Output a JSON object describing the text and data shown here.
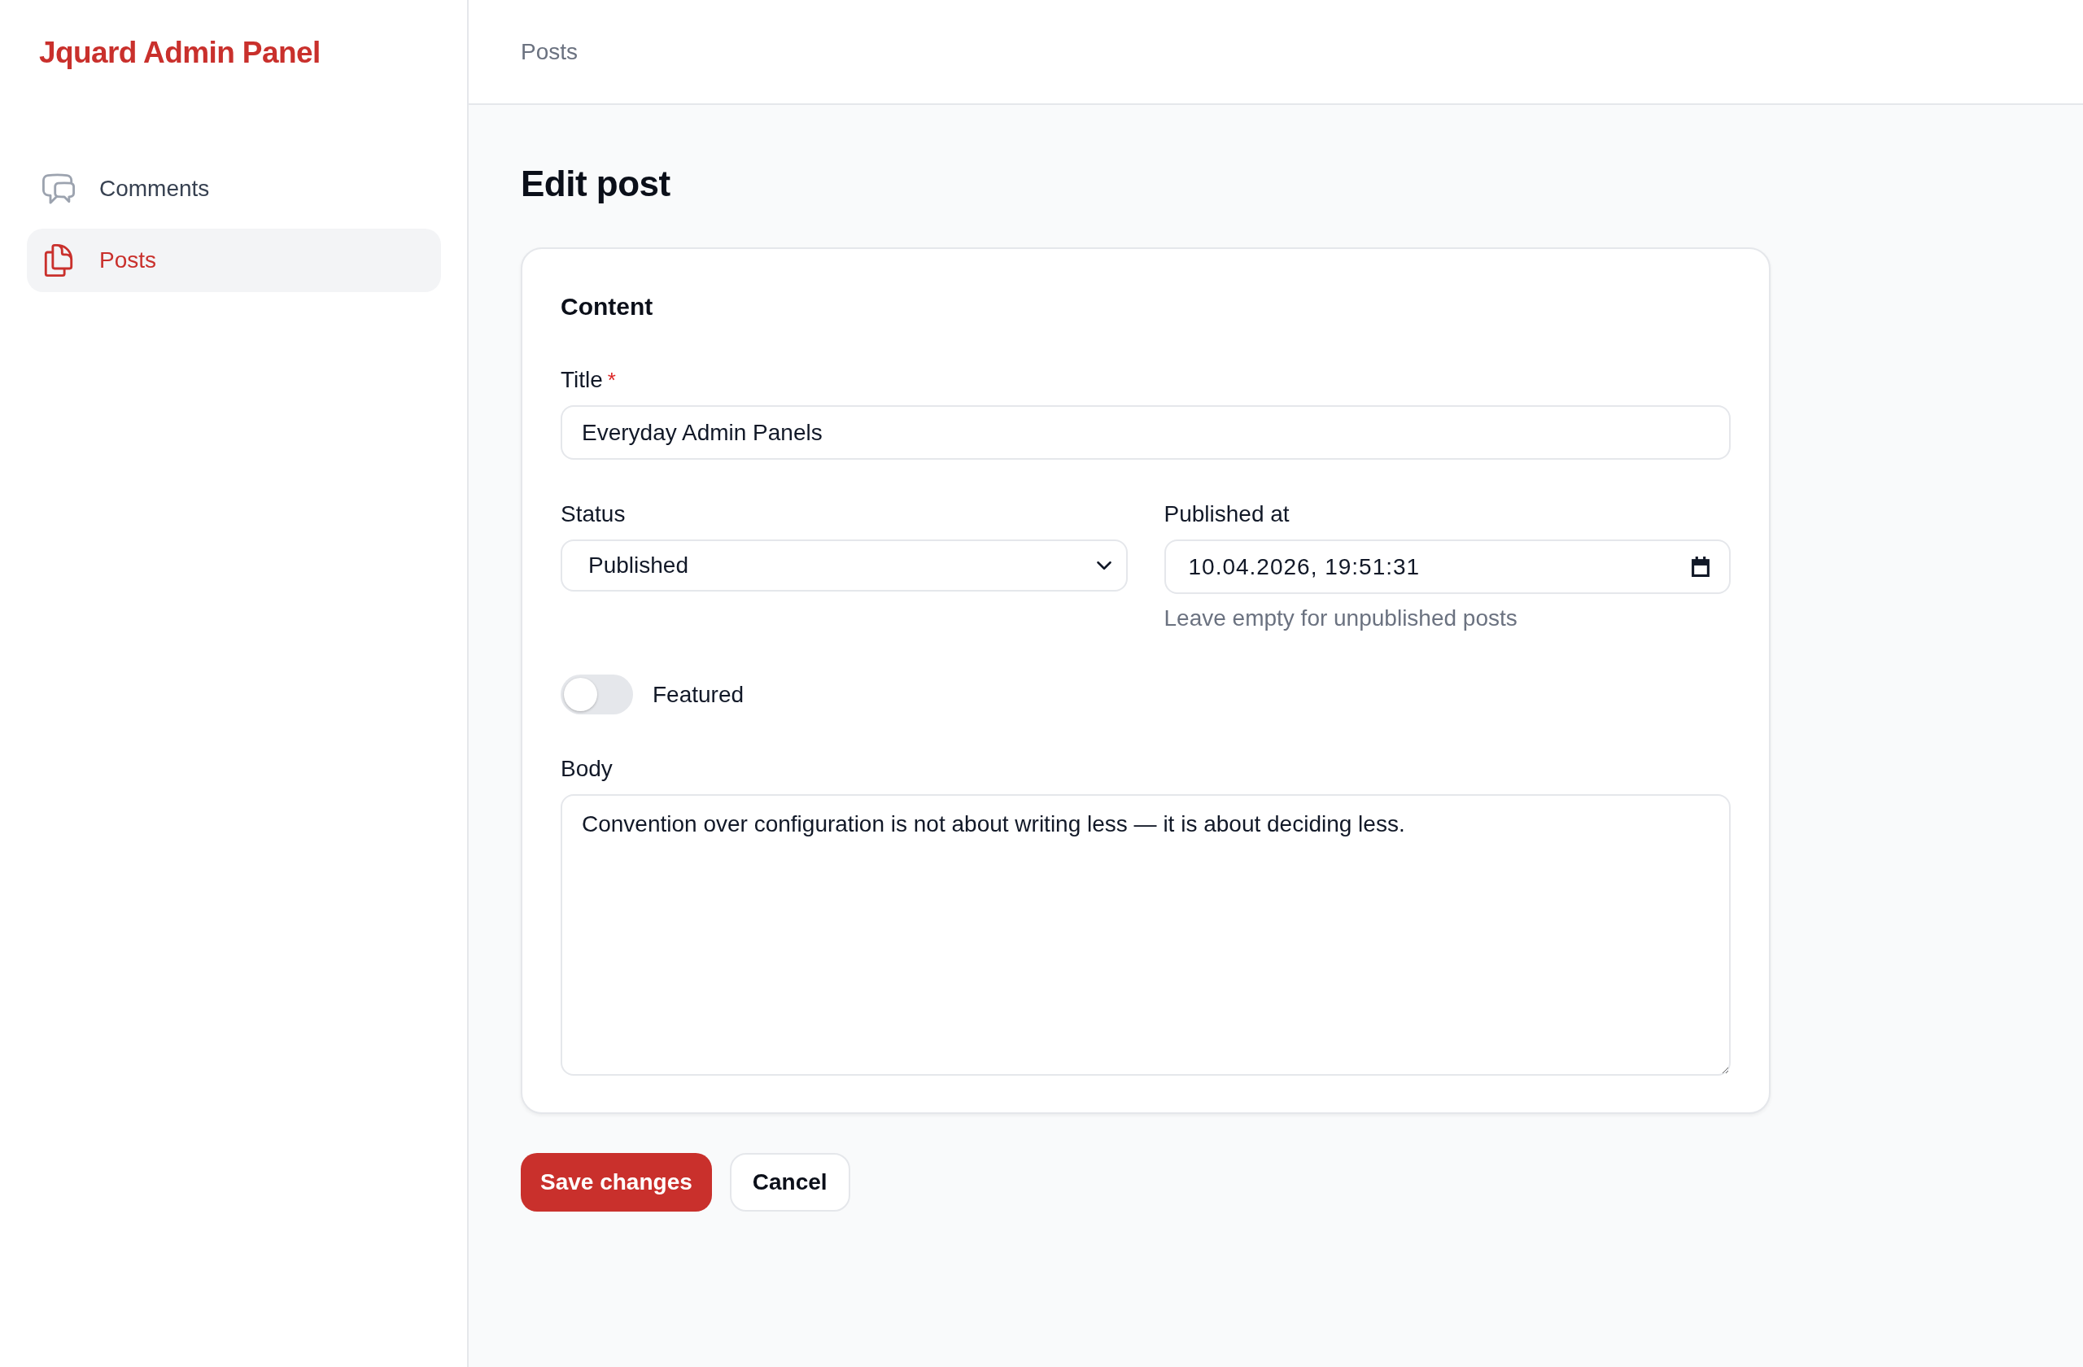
{
  "sidebar": {
    "logo": "Jquard Admin Panel",
    "items": [
      {
        "label": "Comments",
        "selected": false
      },
      {
        "label": "Posts",
        "selected": true
      }
    ]
  },
  "header": {
    "breadcrumb": "Posts"
  },
  "page": {
    "title": "Edit post"
  },
  "form": {
    "section_title": "Content",
    "title_field": {
      "label": "Title",
      "required_mark": "*",
      "value": "Everyday Admin Panels"
    },
    "status_field": {
      "label": "Status",
      "value": "Published"
    },
    "published_at_field": {
      "label": "Published at",
      "value": "10.04.2026, 19:51:31",
      "help": "Leave empty for unpublished posts"
    },
    "featured": {
      "label": "Featured",
      "on": false
    },
    "body_field": {
      "label": "Body",
      "value": "Convention over configuration is not about writing less — it is about deciding less."
    }
  },
  "actions": [
    {
      "label": "Save changes",
      "kind": "primary"
    },
    {
      "label": "Cancel",
      "kind": "secondary"
    }
  ]
}
